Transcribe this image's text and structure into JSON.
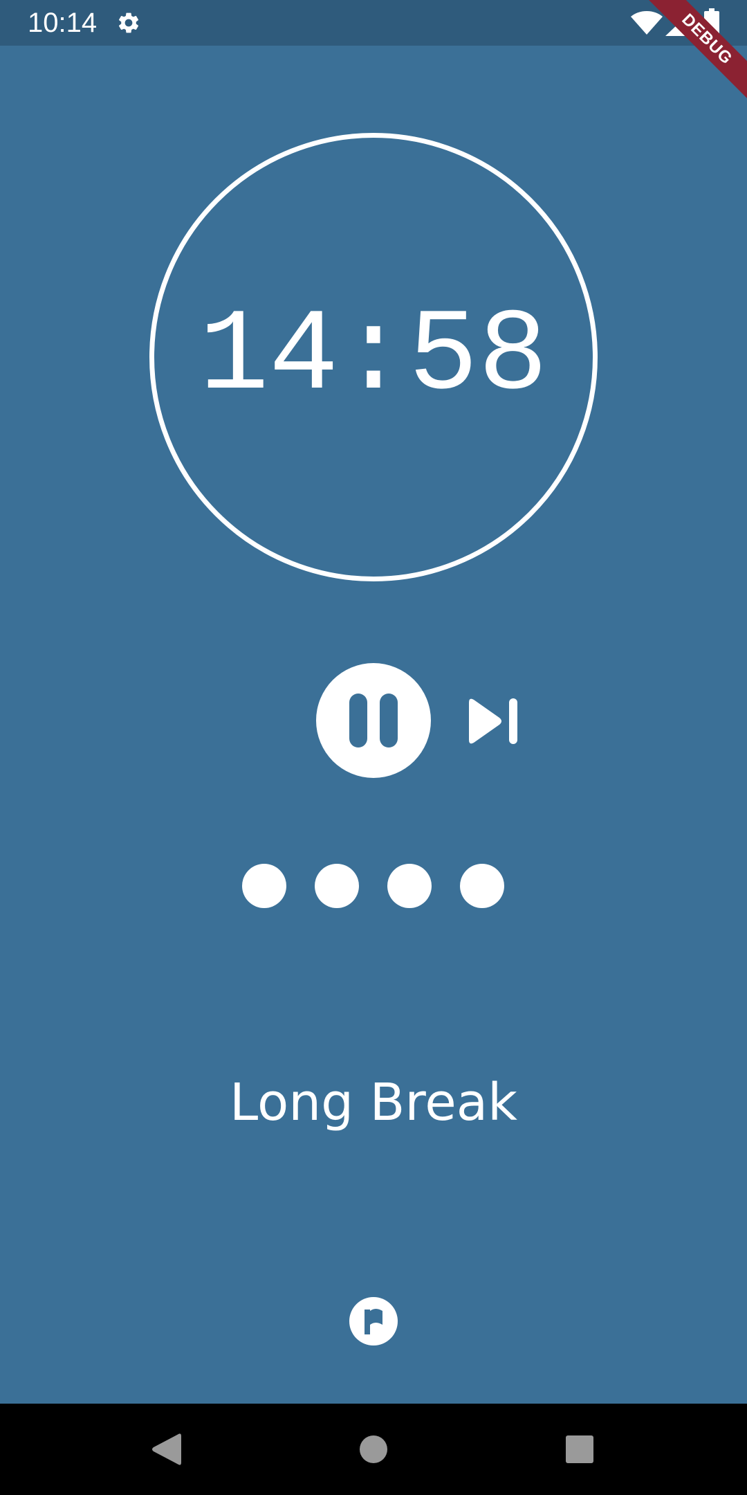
{
  "status_bar": {
    "time": "10:14",
    "icons": [
      "settings-gear-icon",
      "wifi-icon",
      "cell-signal-icon",
      "battery-icon"
    ]
  },
  "debug_banner": {
    "label": "DEBUG",
    "color": "#8B2232"
  },
  "timer": {
    "display": "14:58"
  },
  "controls": {
    "pause_icon": "pause-icon",
    "skip_icon": "skip-next-icon"
  },
  "sessions": {
    "dots_count": 4
  },
  "session_label": "Long Break",
  "flag_icon": "flag-icon",
  "navigation": {
    "back_icon": "back-triangle-icon",
    "home_icon": "home-circle-icon",
    "recents_icon": "recents-square-icon"
  },
  "colors": {
    "background": "#3B7097",
    "status_bar": "#2F5B7C",
    "foreground": "#FFFFFF",
    "nav_bar": "#000000"
  }
}
